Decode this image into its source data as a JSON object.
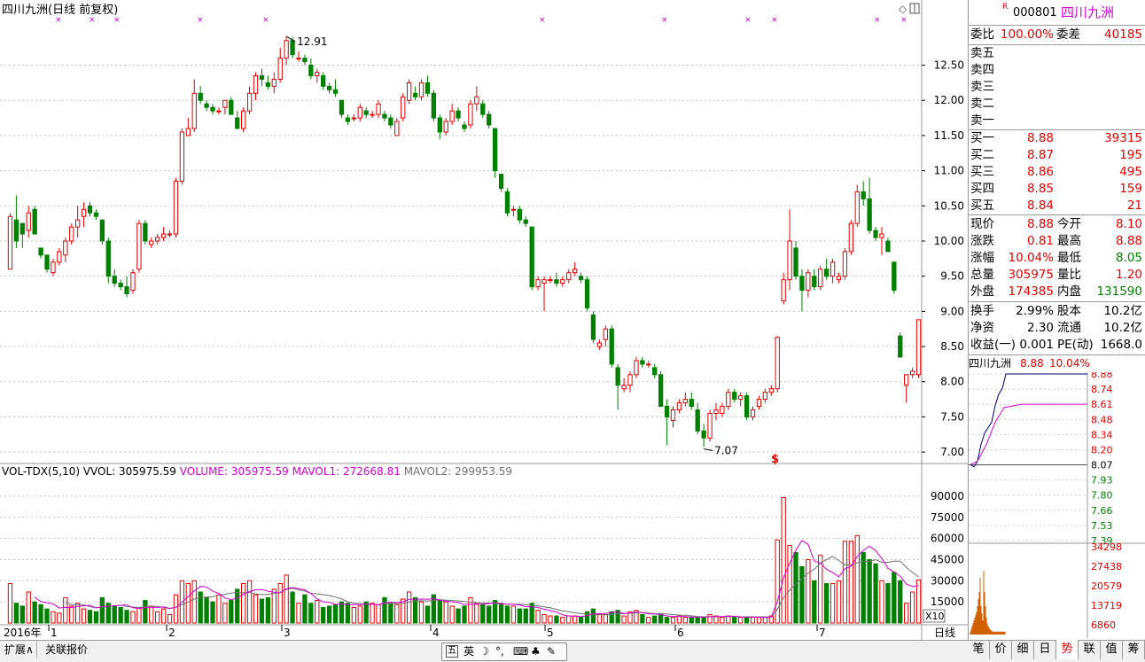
{
  "chart_header": {
    "title": "四川九洲(日线 前复权)",
    "max_label": "12.91",
    "min_label": "7.07",
    "special_mark": "$"
  },
  "price_axis": [
    "12.50",
    "12.00",
    "11.50",
    "11.00",
    "10.50",
    "10.00",
    "9.50",
    "9.00",
    "8.50",
    "8.00",
    "7.50",
    "7.00"
  ],
  "volume_header": {
    "name": "VOL-TDX(5,10)",
    "vvol": "VVOL: 305975.59",
    "volume": "VOLUME: 305975.59",
    "mavol1": "MAVOL1: 272668.81",
    "mavol2": "MAVOL2: 299953.59"
  },
  "volume_axis": [
    "90000",
    "75000",
    "60000",
    "45000",
    "30000",
    "15000"
  ],
  "volume_unit": "X10",
  "date_axis": {
    "year": "2016年",
    "months": [
      "1",
      "2",
      "3",
      "4",
      "5",
      "6",
      "7"
    ]
  },
  "period_label": "日线",
  "bottom_tabs": [
    "扩展∧",
    "关联报价"
  ],
  "ime_bar": {
    "lang": "英",
    "mode_icon": "五"
  },
  "quote": {
    "flag": "R",
    "code": "000801",
    "name": "四川九洲",
    "weibi_label": "委比",
    "weibi": "100.00%",
    "weicha_label": "委差",
    "weicha": "40185",
    "sells": [
      {
        "label": "卖五",
        "price": "",
        "vol": ""
      },
      {
        "label": "卖四",
        "price": "",
        "vol": ""
      },
      {
        "label": "卖三",
        "price": "",
        "vol": ""
      },
      {
        "label": "卖二",
        "price": "",
        "vol": ""
      },
      {
        "label": "卖一",
        "price": "",
        "vol": ""
      }
    ],
    "buys": [
      {
        "label": "买一",
        "price": "8.88",
        "vol": "39315"
      },
      {
        "label": "买二",
        "price": "8.87",
        "vol": "195"
      },
      {
        "label": "买三",
        "price": "8.86",
        "vol": "495"
      },
      {
        "label": "买四",
        "price": "8.85",
        "vol": "159"
      },
      {
        "label": "买五",
        "price": "8.84",
        "vol": "21"
      }
    ],
    "stats": [
      {
        "l1": "现价",
        "v1": "8.88",
        "l2": "今开",
        "v2": "8.10",
        "c1": "red",
        "c2": "red"
      },
      {
        "l1": "涨跌",
        "v1": "0.81",
        "l2": "最高",
        "v2": "8.88",
        "c1": "red",
        "c2": "red"
      },
      {
        "l1": "涨幅",
        "v1": "10.04%",
        "l2": "最低",
        "v2": "8.05",
        "c1": "red",
        "c2": "green"
      },
      {
        "l1": "总量",
        "v1": "305975",
        "l2": "量比",
        "v2": "1.20",
        "c1": "red",
        "c2": "red"
      },
      {
        "l1": "外盘",
        "v1": "174385",
        "l2": "内盘",
        "v2": "131590",
        "c1": "red",
        "c2": "green"
      }
    ],
    "fundamentals": [
      {
        "l1": "换手",
        "v1": "2.99%",
        "l2": "股本",
        "v2": "10.2亿"
      },
      {
        "l1": "净资",
        "v1": "2.30",
        "l2": "流通",
        "v2": "10.2亿"
      },
      {
        "l1": "收益(一)",
        "v1": "0.001",
        "l2": "PE(动)",
        "v2": "1668.0"
      }
    ],
    "mini_title": "四川九洲",
    "mini_price": "8.88",
    "mini_pct": "10.04%",
    "mini_price_axis": [
      "8.88",
      "8.74",
      "8.61",
      "8.48",
      "8.34",
      "8.20",
      "8.07",
      "7.93",
      "7.80",
      "7.66",
      "7.53",
      "7.39"
    ],
    "mini_vol_axis": [
      "34298",
      "27438",
      "20579",
      "13719",
      "6860"
    ],
    "tabs": [
      "笔",
      "价",
      "细",
      "日",
      "势",
      "联",
      "值",
      "筹"
    ],
    "active_tab": "势"
  },
  "colors": {
    "up": "#e60000",
    "down": "#008000",
    "ma1": "#d400d4",
    "ma2": "#707070",
    "grid": "#c0c0c0"
  },
  "chart_data": [
    {
      "type": "candlestick",
      "title": "四川九洲(日线 前复权)",
      "y_axis_ticks": [
        12.5,
        12.0,
        11.5,
        11.0,
        10.5,
        10.0,
        9.5,
        9.0,
        8.5,
        8.0,
        7.5,
        7.0
      ],
      "ylim": [
        6.85,
        13.2
      ],
      "annotations": [
        {
          "label": "12.91",
          "type": "high"
        },
        {
          "label": "7.07",
          "type": "low"
        }
      ],
      "ohlc": [
        [
          9.6,
          10.4,
          9.6,
          10.35
        ],
        [
          10.3,
          10.65,
          9.9,
          10.0
        ],
        [
          10.25,
          10.25,
          9.9,
          10.1
        ],
        [
          10.15,
          10.5,
          10.05,
          10.4
        ],
        [
          10.45,
          10.5,
          10.1,
          10.1
        ],
        [
          9.9,
          9.9,
          9.75,
          9.8
        ],
        [
          9.8,
          9.8,
          9.55,
          9.6
        ],
        [
          9.55,
          9.75,
          9.5,
          9.7
        ],
        [
          9.7,
          9.9,
          9.65,
          9.85
        ],
        [
          9.8,
          10.05,
          9.7,
          10.0
        ],
        [
          10.0,
          10.25,
          9.95,
          10.2
        ],
        [
          10.2,
          10.5,
          10.05,
          10.3
        ],
        [
          10.35,
          10.55,
          10.2,
          10.45
        ],
        [
          10.5,
          10.55,
          10.35,
          10.4
        ],
        [
          10.4,
          10.45,
          10.3,
          10.35
        ],
        [
          10.3,
          10.3,
          9.95,
          10.0
        ],
        [
          10.0,
          10.05,
          9.4,
          9.5
        ],
        [
          9.5,
          9.6,
          9.35,
          9.4
        ],
        [
          9.4,
          9.45,
          9.3,
          9.35
        ],
        [
          9.35,
          9.5,
          9.2,
          9.25
        ],
        [
          9.3,
          9.6,
          9.25,
          9.55
        ],
        [
          9.6,
          10.3,
          9.55,
          10.25
        ],
        [
          10.25,
          10.3,
          9.95,
          10.0
        ],
        [
          9.95,
          10.05,
          9.9,
          10.0
        ],
        [
          10.0,
          10.1,
          9.95,
          10.05
        ],
        [
          10.05,
          10.2,
          10.0,
          10.1
        ],
        [
          10.1,
          10.15,
          10.05,
          10.1
        ],
        [
          10.1,
          10.9,
          10.05,
          10.85
        ],
        [
          10.85,
          11.6,
          10.8,
          11.55
        ],
        [
          11.5,
          11.75,
          11.5,
          11.6
        ],
        [
          11.6,
          12.3,
          11.55,
          12.1
        ],
        [
          12.1,
          12.2,
          11.95,
          12.0
        ],
        [
          11.95,
          12.0,
          11.85,
          11.9
        ],
        [
          11.9,
          11.95,
          11.8,
          11.85
        ],
        [
          11.85,
          11.9,
          11.8,
          11.85
        ],
        [
          11.9,
          12.0,
          11.8,
          12.0
        ],
        [
          12.0,
          12.05,
          11.8,
          11.8
        ],
        [
          11.75,
          11.85,
          11.6,
          11.6
        ],
        [
          11.6,
          11.9,
          11.55,
          11.85
        ],
        [
          11.85,
          12.2,
          11.8,
          12.1
        ],
        [
          12.1,
          12.4,
          12.0,
          12.35
        ],
        [
          12.35,
          12.45,
          12.2,
          12.3
        ],
        [
          12.25,
          12.35,
          12.15,
          12.2
        ],
        [
          12.2,
          12.4,
          12.1,
          12.3
        ],
        [
          12.3,
          12.75,
          12.25,
          12.6
        ],
        [
          12.6,
          12.91,
          12.5,
          12.85
        ],
        [
          12.85,
          12.9,
          12.6,
          12.65
        ],
        [
          12.6,
          12.7,
          12.55,
          12.6
        ],
        [
          12.6,
          12.65,
          12.5,
          12.55
        ],
        [
          12.5,
          12.6,
          12.3,
          12.35
        ],
        [
          12.35,
          12.45,
          12.25,
          12.4
        ],
        [
          12.35,
          12.4,
          12.15,
          12.2
        ],
        [
          12.2,
          12.25,
          12.1,
          12.15
        ],
        [
          12.15,
          12.3,
          12.05,
          12.1
        ],
        [
          12.0,
          12.0,
          11.75,
          11.8
        ],
        [
          11.75,
          11.8,
          11.65,
          11.7
        ],
        [
          11.75,
          11.8,
          11.7,
          11.75
        ],
        [
          11.75,
          11.95,
          11.7,
          11.9
        ],
        [
          11.85,
          11.9,
          11.75,
          11.8
        ],
        [
          11.8,
          11.85,
          11.75,
          11.8
        ],
        [
          11.8,
          12.0,
          11.75,
          11.95
        ],
        [
          11.8,
          11.85,
          11.7,
          11.75
        ],
        [
          11.75,
          11.8,
          11.6,
          11.65
        ],
        [
          11.5,
          11.75,
          11.5,
          11.7
        ],
        [
          11.75,
          12.1,
          11.7,
          12.05
        ],
        [
          12.0,
          12.3,
          11.95,
          12.25
        ],
        [
          12.1,
          12.2,
          12.0,
          12.05
        ],
        [
          12.05,
          12.3,
          12.0,
          12.25
        ],
        [
          12.25,
          12.35,
          12.05,
          12.1
        ],
        [
          12.1,
          12.15,
          11.7,
          11.75
        ],
        [
          11.75,
          11.8,
          11.45,
          11.55
        ],
        [
          11.55,
          11.75,
          11.5,
          11.7
        ],
        [
          11.7,
          11.95,
          11.65,
          11.85
        ],
        [
          11.85,
          11.9,
          11.7,
          11.75
        ],
        [
          11.65,
          11.7,
          11.55,
          11.6
        ],
        [
          11.65,
          12.0,
          11.6,
          11.95
        ],
        [
          11.95,
          12.2,
          11.85,
          12.05
        ],
        [
          11.95,
          12.0,
          11.75,
          11.8
        ],
        [
          11.8,
          11.85,
          11.6,
          11.65
        ],
        [
          11.6,
          11.6,
          10.9,
          11.0
        ],
        [
          10.95,
          10.95,
          10.7,
          10.75
        ],
        [
          10.7,
          10.75,
          10.35,
          10.4
        ],
        [
          10.45,
          10.5,
          10.35,
          10.45
        ],
        [
          10.45,
          10.5,
          10.25,
          10.3
        ],
        [
          10.3,
          10.35,
          10.2,
          10.25
        ],
        [
          10.2,
          10.2,
          9.3,
          9.35
        ],
        [
          9.35,
          9.5,
          9.3,
          9.45
        ],
        [
          9.4,
          9.5,
          9.0,
          9.45
        ],
        [
          9.45,
          9.5,
          9.4,
          9.45
        ],
        [
          9.45,
          9.55,
          9.35,
          9.4
        ],
        [
          9.4,
          9.5,
          9.35,
          9.45
        ],
        [
          9.45,
          9.6,
          9.4,
          9.55
        ],
        [
          9.55,
          9.7,
          9.5,
          9.6
        ],
        [
          9.5,
          9.55,
          9.4,
          9.45
        ],
        [
          9.45,
          9.5,
          9.0,
          9.05
        ],
        [
          8.95,
          9.0,
          8.55,
          8.6
        ],
        [
          8.5,
          8.6,
          8.45,
          8.55
        ],
        [
          8.6,
          8.8,
          8.5,
          8.75
        ],
        [
          8.75,
          8.8,
          8.2,
          8.25
        ],
        [
          8.2,
          8.25,
          7.6,
          7.95
        ],
        [
          7.9,
          8.05,
          7.85,
          7.95
        ],
        [
          7.95,
          8.15,
          7.85,
          8.1
        ],
        [
          8.1,
          8.35,
          8.05,
          8.3
        ],
        [
          8.3,
          8.35,
          8.2,
          8.25
        ],
        [
          8.25,
          8.3,
          8.2,
          8.25
        ],
        [
          8.2,
          8.25,
          8.05,
          8.1
        ],
        [
          8.1,
          8.15,
          7.65,
          7.65
        ],
        [
          7.65,
          7.75,
          7.1,
          7.5
        ],
        [
          7.45,
          7.65,
          7.35,
          7.6
        ],
        [
          7.6,
          7.75,
          7.55,
          7.7
        ],
        [
          7.7,
          7.85,
          7.65,
          7.75
        ],
        [
          7.75,
          7.85,
          7.6,
          7.65
        ],
        [
          7.6,
          7.7,
          7.25,
          7.3
        ],
        [
          7.3,
          7.4,
          7.07,
          7.2
        ],
        [
          7.2,
          7.6,
          7.15,
          7.55
        ],
        [
          7.55,
          7.7,
          7.45,
          7.6
        ],
        [
          7.55,
          7.7,
          7.5,
          7.65
        ],
        [
          7.65,
          7.9,
          7.6,
          7.85
        ],
        [
          7.85,
          7.9,
          7.7,
          7.75
        ],
        [
          7.75,
          7.85,
          7.65,
          7.8
        ],
        [
          7.8,
          7.85,
          7.45,
          7.5
        ],
        [
          7.5,
          7.65,
          7.45,
          7.6
        ],
        [
          7.65,
          7.8,
          7.6,
          7.75
        ],
        [
          7.75,
          7.9,
          7.7,
          7.85
        ],
        [
          7.85,
          7.95,
          7.8,
          7.9
        ],
        [
          7.9,
          8.65,
          7.85,
          8.63
        ],
        [
          9.15,
          9.55,
          9.1,
          9.45
        ],
        [
          9.45,
          10.45,
          9.3,
          10.0
        ],
        [
          9.9,
          10.0,
          9.45,
          9.5
        ],
        [
          9.5,
          9.6,
          9.0,
          9.3
        ],
        [
          9.3,
          9.6,
          9.2,
          9.55
        ],
        [
          9.5,
          9.6,
          9.3,
          9.35
        ],
        [
          9.35,
          9.65,
          9.3,
          9.6
        ],
        [
          9.6,
          9.75,
          9.45,
          9.5
        ],
        [
          9.5,
          9.75,
          9.4,
          9.7
        ],
        [
          9.45,
          9.55,
          9.4,
          9.5
        ],
        [
          9.5,
          9.9,
          9.45,
          9.85
        ],
        [
          9.85,
          10.3,
          9.8,
          10.25
        ],
        [
          10.25,
          10.8,
          10.2,
          10.7
        ],
        [
          10.7,
          10.85,
          10.5,
          10.6
        ],
        [
          10.6,
          10.9,
          10.1,
          10.15
        ],
        [
          10.15,
          10.2,
          10.0,
          10.05
        ],
        [
          10.05,
          10.2,
          9.8,
          10.1
        ],
        [
          10.0,
          10.05,
          9.85,
          9.85
        ],
        [
          9.7,
          9.7,
          9.25,
          9.3
        ],
        [
          8.65,
          8.7,
          8.35,
          8.35
        ],
        [
          7.95,
          8.1,
          7.7,
          8.1
        ],
        [
          8.1,
          8.2,
          8.05,
          8.15
        ],
        [
          8.1,
          8.88,
          8.05,
          8.88
        ]
      ],
      "volume": [
        28000,
        14000,
        12000,
        22000,
        15000,
        13000,
        10000,
        8000,
        7000,
        18000,
        12000,
        14000,
        10000,
        9000,
        8000,
        18000,
        14000,
        12000,
        11000,
        9000,
        8000,
        11000,
        16000,
        12000,
        8000,
        10000,
        6000,
        20000,
        30000,
        28000,
        30000,
        22000,
        18000,
        15000,
        20000,
        14000,
        16000,
        24000,
        28000,
        30000,
        20000,
        17000,
        18000,
        24000,
        28000,
        34000,
        22000,
        14000,
        20000,
        14000,
        16000,
        11000,
        12000,
        13000,
        15000,
        14000,
        11000,
        12000,
        15000,
        14000,
        13000,
        18000,
        14000,
        13000,
        17000,
        22000,
        18000,
        15000,
        12000,
        20000,
        16000,
        15000,
        12000,
        10000,
        12000,
        18000,
        14000,
        13000,
        12000,
        16000,
        14000,
        12000,
        12000,
        10000,
        10000,
        14000,
        9000,
        6000,
        5000,
        5000,
        4000,
        5000,
        5000,
        4000,
        8000,
        10000,
        6000,
        6000,
        8000,
        9000,
        5000,
        8000,
        9000,
        6000,
        4000,
        5000,
        6000,
        4000,
        4000,
        5000,
        4000,
        4000,
        4000,
        4000,
        6000,
        5000,
        4000,
        5000,
        4000,
        4000,
        4000,
        4000,
        4000,
        4000,
        5000,
        59000,
        89000,
        55000,
        50000,
        40000,
        45000,
        30000,
        48000,
        28000,
        28000,
        30000,
        58000,
        58000,
        62000,
        50000,
        45000,
        42000,
        30000,
        28000,
        36000,
        30000,
        14000,
        22000,
        30597
      ],
      "vol_ylim": [
        0,
        100000
      ],
      "series": [
        {
          "name": "MAVOL1",
          "role": "ma5"
        },
        {
          "name": "MAVOL2",
          "role": "ma10"
        }
      ]
    }
  ]
}
